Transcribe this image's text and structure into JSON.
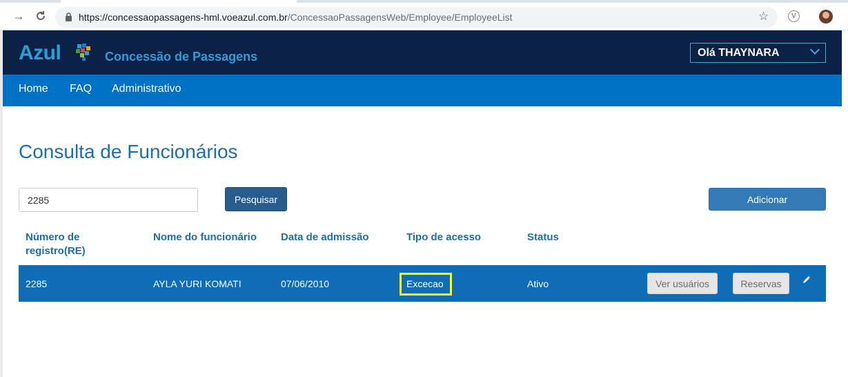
{
  "browser": {
    "url_domain": "https://concessaopassagens-hml.voeazul.com.br",
    "url_path": "/ConcessaoPassagensWeb/Employee/EmployeeList"
  },
  "header": {
    "logo_text": "Azul",
    "app_title": "Concessão de Passagens",
    "user_greeting": "Olá THAYNARA",
    "colors": {
      "header_bg": "#0b2146",
      "navbar_bg": "#0072c6",
      "accent": "#2d9cdb"
    }
  },
  "nav": {
    "items": [
      "Home",
      "FAQ",
      "Administrativo"
    ]
  },
  "page": {
    "title": "Consulta de Funcionários",
    "search_value": "2285",
    "search_button": "Pesquisar",
    "add_button": "Adicionar"
  },
  "table": {
    "columns": [
      "Número de registro(RE)",
      "Nome do funcionário",
      "Data de admissão",
      "Tipo de acesso",
      "Status"
    ],
    "rows": [
      {
        "re": "2285",
        "name": "AYLA YURI KOMATI",
        "admission": "07/06/2010",
        "access_type": "Excecao",
        "status": "Ativo",
        "btn_users": "Ver usuários",
        "btn_reservations": "Reservas"
      }
    ]
  }
}
